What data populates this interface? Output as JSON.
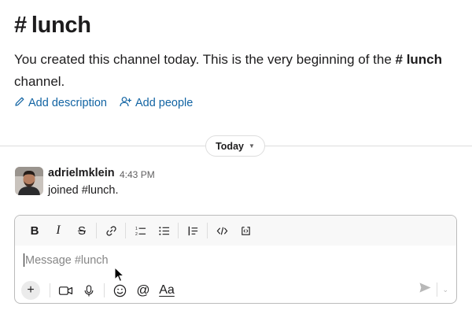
{
  "channel": {
    "hash": "#",
    "name": "lunch",
    "intro_text": "You created this channel today. This is the very beginning of the",
    "intro_channel": "# lunch",
    "intro_suffix": "channel."
  },
  "actions": {
    "add_description": "Add description",
    "add_people": "Add people"
  },
  "divider": {
    "label": "Today"
  },
  "message": {
    "author": "adrielmklein",
    "time": "4:43 PM",
    "body": "joined #lunch."
  },
  "composer": {
    "placeholder": "Message #lunch",
    "text_style_label": "Aa"
  },
  "colors": {
    "link": "#1264a3",
    "text": "#1d1c1d",
    "muted": "#616061",
    "border": "#dddddd"
  }
}
